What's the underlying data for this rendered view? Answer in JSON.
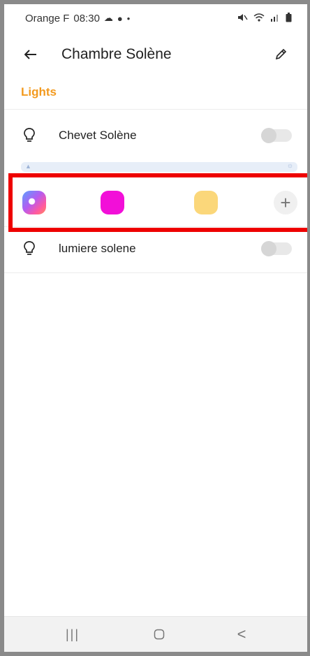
{
  "status_bar": {
    "carrier": "Orange F",
    "time": "08:30",
    "left_icons": [
      "cloud-icon",
      "leaf-icon",
      "dot-icon"
    ],
    "right_icons": [
      "mute-icon",
      "wifi-icon",
      "signal-icon",
      "battery-icon"
    ]
  },
  "header": {
    "title": "Chambre Solène",
    "back_icon": "arrow-left-icon",
    "edit_icon": "pencil-icon"
  },
  "section": {
    "title": "Lights"
  },
  "lights": [
    {
      "name": "Chevet Solène",
      "icon": "lightbulb-icon",
      "on": false
    },
    {
      "name": "lumiere solene",
      "icon": "lightbulb-icon",
      "on": false
    }
  ],
  "color_presets": {
    "swatches": [
      {
        "name": "multicolor",
        "color": "#b65cf0"
      },
      {
        "name": "magenta",
        "color": "#f20fd8"
      },
      {
        "name": "warm-yellow",
        "color": "#fbd77a"
      }
    ],
    "add_label": "+"
  },
  "colors": {
    "accent": "#f39a1e",
    "highlight": "#ee0000"
  },
  "nav_bar": {
    "recents": "|||",
    "back": "<"
  }
}
